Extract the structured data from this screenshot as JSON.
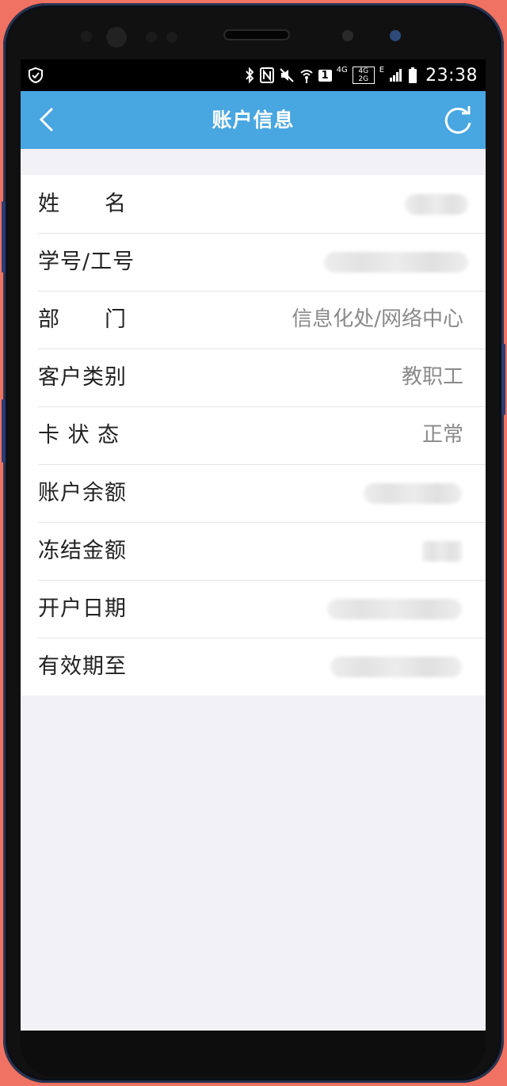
{
  "status_bar": {
    "time": "23:38",
    "network_primary": "4G",
    "network_secondary": "4G 2G",
    "edge_indicator": "E",
    "sim_badge": "1",
    "icons": [
      "shield-icon",
      "bluetooth-icon",
      "nfc-icon",
      "mute-icon",
      "wifi-icon",
      "signal-icon",
      "battery-icon"
    ]
  },
  "nav": {
    "title": "账户信息",
    "back_icon": "chevron-left-icon",
    "refresh_icon": "refresh-icon"
  },
  "account_rows": [
    {
      "label": "姓　　名",
      "value": "",
      "obscured": true
    },
    {
      "label": "学号/工号",
      "value": "",
      "obscured": true
    },
    {
      "label": "部　　门",
      "value": "信息化处/网络中心",
      "obscured": false
    },
    {
      "label": "客户类别",
      "value": "教职工",
      "obscured": false
    },
    {
      "label": "卡 状 态",
      "value": "正常",
      "obscured": false
    },
    {
      "label": "账户余额",
      "value": "",
      "obscured": true
    },
    {
      "label": "冻结金额",
      "value": "",
      "obscured": true
    },
    {
      "label": "开户日期",
      "value": "",
      "obscured": true
    },
    {
      "label": "有效期至",
      "value": "",
      "obscured": true
    }
  ],
  "colors": {
    "nav_bar": "#48a6e0",
    "background": "#f2f1f6",
    "frame": "#f07262"
  }
}
